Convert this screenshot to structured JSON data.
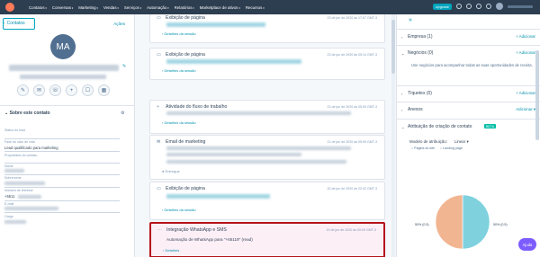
{
  "nav": {
    "items": [
      "Contatos",
      "Conversas",
      "Marketing",
      "Vendas",
      "Serviços",
      "Automação",
      "Relatórios",
      "Marketplace de ativos",
      "Recursos"
    ],
    "upgrade": "Upgrade"
  },
  "left": {
    "back": "Contatos",
    "actions": "Ações",
    "initials": "MA",
    "about": "Sobre este contato",
    "props": [
      {
        "label": "Status do lead",
        "value": ""
      },
      {
        "label": "Fase do ciclo de vida",
        "value": "Lead qualificado para marketing"
      },
      {
        "label": "Proprietário do contato",
        "value": ""
      },
      {
        "label": "Nome",
        "value": ""
      },
      {
        "label": "Sobrenome",
        "value": ""
      },
      {
        "label": "Número de telefone",
        "value": "+5511"
      },
      {
        "label": "E-mail",
        "value": ""
      },
      {
        "label": "Cargo",
        "value": ""
      }
    ]
  },
  "timeline": [
    {
      "title": "Exibição de página",
      "date": "23 de jun de 2020 às 17:07 GMT-3",
      "detail": "Detalhes da sessão"
    },
    {
      "title": "Exibição de página",
      "date": "23 de jun de 2020 às 05:14 GMT-3",
      "detail": "Detalhes da sessão"
    },
    {
      "title": "Atividade do fluxo de trabalho",
      "date": "21 de jun de 2020 às 05:09 GMT-3",
      "detail": "Detalhes da sessão"
    },
    {
      "title": "Email de marketing",
      "date": "21 de jun de 2020 às 05:09 GMT-3",
      "detail": "Entregue"
    },
    {
      "title": "Exibição de página",
      "date": "20 de jun de 2020 às 22:02 GMT-3",
      "detail": "Detalhes da sessão"
    },
    {
      "title": "Integração WhatsApp e SMS",
      "date": "19 de jun de 2020 às 00:09 GMT-3",
      "body": "Automação de WhatsApp para \"+55119\" (read)",
      "detail": "Detalhes"
    }
  ],
  "right": {
    "sections": [
      {
        "title": "Empresa (1)",
        "add": "+ Adicionar"
      },
      {
        "title": "Negócios (0)",
        "add": "+ Adicionar",
        "body": "Use negócios para acompanhar todas as suas oportunidades de receita."
      },
      {
        "title": "Tíquetes (0)",
        "add": "+ Adicionar"
      },
      {
        "title": "Anexos",
        "add": "Adicionar"
      }
    ],
    "attribution": {
      "title": "Atribuição de criação de contato",
      "badge": "BETA",
      "model_label": "Modelo de atribuição:",
      "model_value": "Linear",
      "legend": [
        "Página do site",
        "Landing page"
      ],
      "left_pct": "50% (0.5)",
      "right_pct": "50% (0.5)"
    }
  },
  "chart_data": {
    "type": "pie",
    "labels": [
      "Página do site",
      "Landing page"
    ],
    "values": [
      0.5,
      0.5
    ],
    "colors": [
      "#7fd1de",
      "#f2b591"
    ]
  },
  "help": "Ajuda",
  "colors": {
    "highlight": "#b5121b",
    "nav": "#2d3e50",
    "link": "#0091ae"
  }
}
